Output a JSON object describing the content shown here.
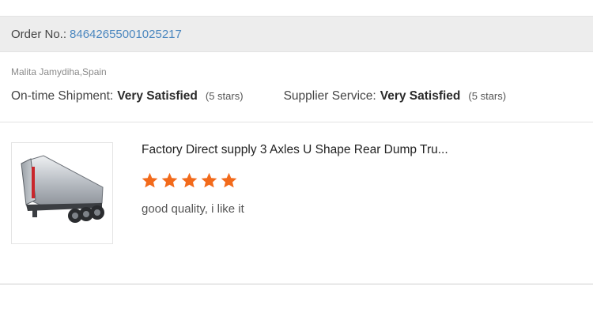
{
  "order": {
    "label": "Order No.:",
    "number": "84642655001025217"
  },
  "buyer": {
    "name_location": "Malita Jamydiha,Spain"
  },
  "ratings": {
    "shipment": {
      "label": "On-time Shipment:",
      "value": "Very Satisfied",
      "stars_text": "(5 stars)"
    },
    "supplier": {
      "label": "Supplier Service:",
      "value": "Very Satisfied",
      "stars_text": "(5 stars)"
    }
  },
  "review": {
    "product_title": "Factory Direct supply 3 Axles U Shape Rear Dump Tru...",
    "rating": 5,
    "rating_max": 5,
    "star_color": "#f26a1b",
    "text": "good quality, i like it"
  }
}
